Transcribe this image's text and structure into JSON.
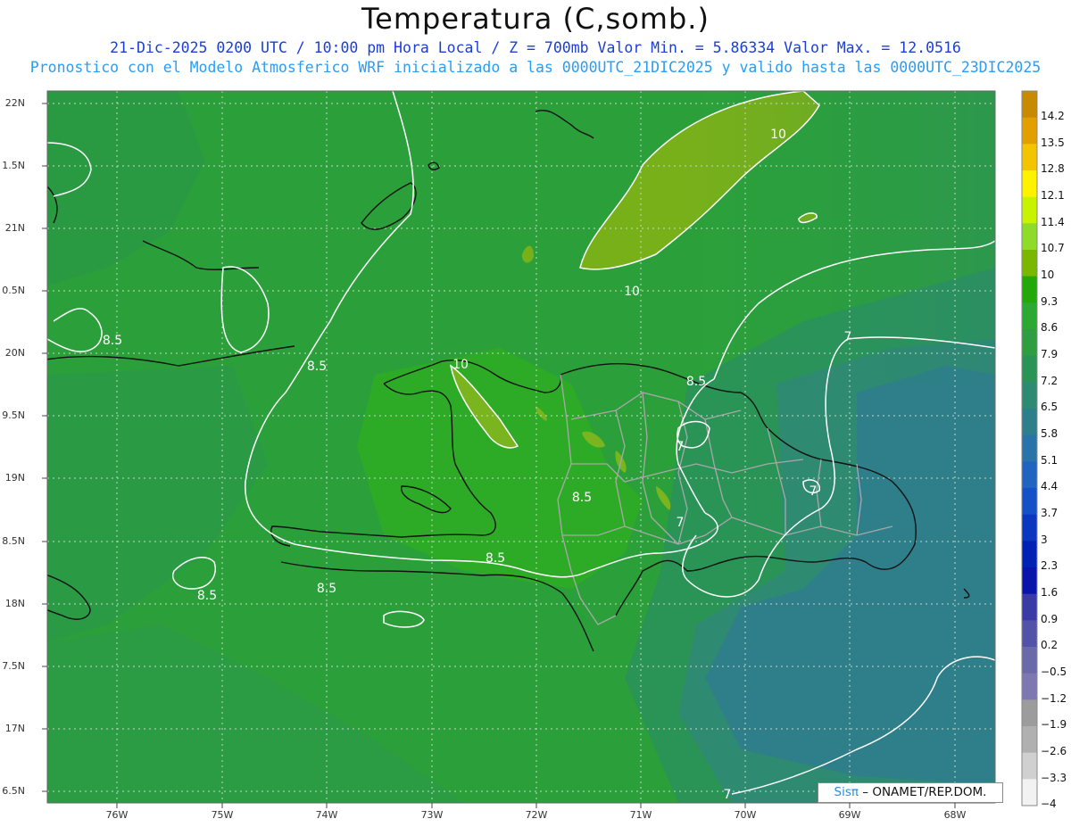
{
  "title": "Temperatura (C,somb.)",
  "subtitle_line1": "21-Dic-2025  0200 UTC / 10:00 pm Hora Local / Z = 700mb   Valor Min. = 5.86334  Valor Max. = 12.0516",
  "subtitle_line2": "Pronostico con el Modelo Atmosferico WRF inicializado a las 0000UTC_21DIC2025 y valido hasta las  0000UTC_23DIC2025",
  "credit": {
    "brand": "Sisπ",
    "text": " – ONAMET/REP.DOM."
  },
  "lat_labels": [
    "22N",
    "1.5N",
    "21N",
    "0.5N",
    "20N",
    "9.5N",
    "19N",
    "8.5N",
    "18N",
    "7.5N",
    "17N",
    "6.5N"
  ],
  "lon_labels": [
    "76W",
    "75W",
    "74W",
    "73W",
    "72W",
    "71W",
    "70W",
    "69W",
    "68W"
  ],
  "colorbar": {
    "labels": [
      "14.2",
      "13.5",
      "12.8",
      "12.1",
      "11.4",
      "10.7",
      "10",
      "9.3",
      "8.6",
      "7.9",
      "7.2",
      "6.5",
      "5.8",
      "5.1",
      "4.4",
      "3.7",
      "3",
      "2.3",
      "1.6",
      "0.9",
      "0.2",
      "−0.5",
      "−1.2",
      "−1.9",
      "−2.6",
      "−3.3",
      "−4"
    ],
    "colors": [
      "#c88a00",
      "#e2a000",
      "#f5c400",
      "#fff200",
      "#c8f200",
      "#8fdb2a",
      "#7ab800",
      "#23a80a",
      "#2ca833",
      "#2e9e41",
      "#2a9457",
      "#2f8a74",
      "#2e7f8c",
      "#2874a8",
      "#1e64c0",
      "#1450c8",
      "#0a36c0",
      "#0022b4",
      "#0a14aa",
      "#3a3aa6",
      "#5252a8",
      "#6a6aaa",
      "#7f78b0",
      "#9c9c9c",
      "#b0b0b0",
      "#d0d0d0",
      "#f2f2f2"
    ]
  },
  "contour_labels": [
    "10",
    "10",
    "10",
    "8.5",
    "8.5",
    "8.5",
    "8.5",
    "8.5",
    "8.5",
    "8.5",
    "7",
    "7",
    "7",
    "7",
    "7"
  ]
}
